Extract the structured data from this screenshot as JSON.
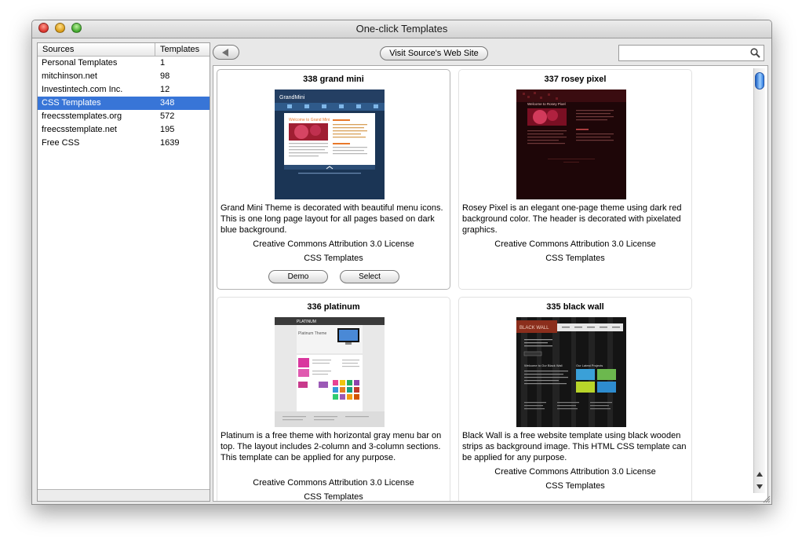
{
  "window": {
    "title": "One-click Templates"
  },
  "sources": {
    "headers": {
      "source": "Sources",
      "templates": "Templates"
    },
    "rows": [
      {
        "name": "Personal Templates",
        "count": "1"
      },
      {
        "name": "mitchinson.net",
        "count": "98"
      },
      {
        "name": "Investintech.com Inc.",
        "count": "12"
      },
      {
        "name": "CSS Templates",
        "count": "348",
        "selected": true
      },
      {
        "name": "freecsstemplates.org",
        "count": "572"
      },
      {
        "name": "freecsstemplate.net",
        "count": "195"
      },
      {
        "name": "Free CSS",
        "count": "1639"
      }
    ]
  },
  "toolbar": {
    "visit_label": "Visit Source's Web Site",
    "search_value": ""
  },
  "templates": [
    {
      "title": "338 grand mini",
      "description": "Grand Mini Theme is decorated with beautiful menu icons. This is one long page layout for all pages based on dark blue background.",
      "license": "Creative Commons Attribution 3.0 License",
      "source": "CSS Templates",
      "demo_label": "Demo",
      "select_label": "Select"
    },
    {
      "title": "337 rosey pixel",
      "description": "Rosey Pixel is an elegant one-page theme using dark red background color. The header is decorated with pixelated graphics.",
      "license": "Creative Commons Attribution 3.0 License",
      "source": "CSS Templates"
    },
    {
      "title": "336 platinum",
      "description": "Platinum is a free theme with horizontal gray menu bar on top. The layout includes 2-column and 3-column sections. This template can be applied for any purpose.",
      "license": "Creative Commons Attribution 3.0 License",
      "source": "CSS Templates"
    },
    {
      "title": "335 black wall",
      "description": "Black Wall is a free website template using black wooden strips as background image. This HTML CSS template can be applied for any purpose.",
      "license": "Creative Commons Attribution 3.0 License",
      "source": "CSS Templates"
    }
  ],
  "thumbnails": {
    "grand_mini": {
      "logo": "GrandMini",
      "welcome": "Welcome to Grand Mini"
    },
    "rosey_pixel": {
      "welcome": "Welcome to Rosey Pixel"
    },
    "platinum": {
      "logo": "PLATINUM",
      "heading": "Platinum Theme"
    },
    "black_wall": {
      "logo": "BLACK WALL",
      "welcome": "Welcome to Our Black Wall",
      "projects": "Our Latest Projects"
    }
  },
  "scroll": {
    "position": 0.02
  }
}
